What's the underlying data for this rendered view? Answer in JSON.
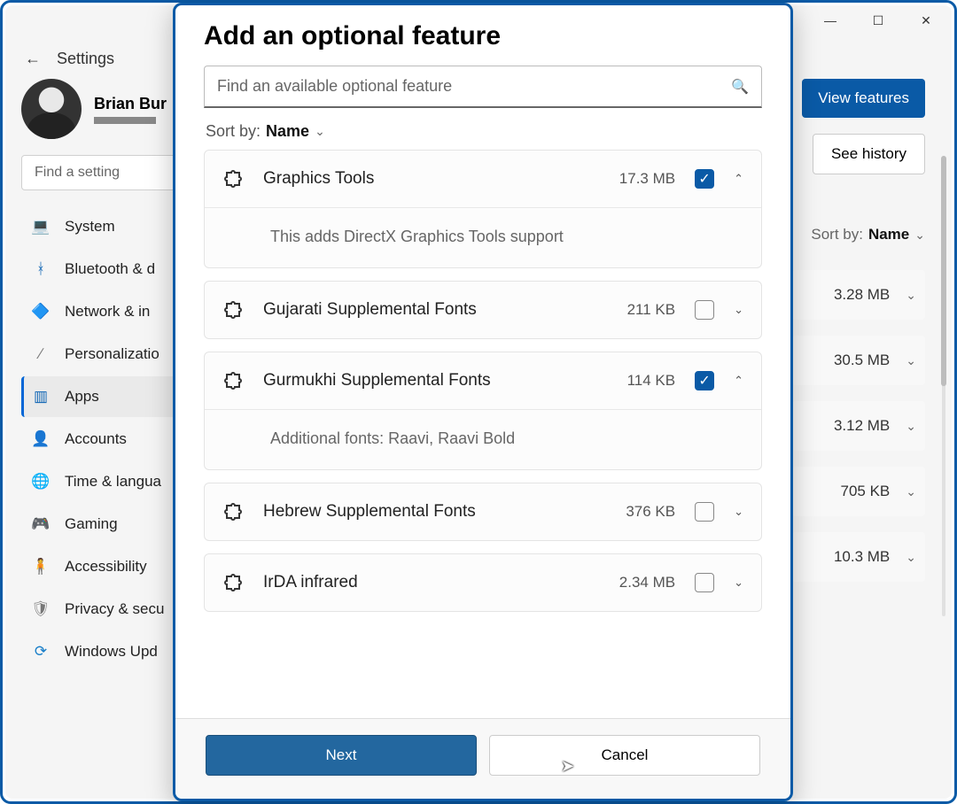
{
  "window": {
    "titlebar": {
      "min": "—",
      "max": "☐",
      "close": "✕"
    },
    "back_icon": "←",
    "app_title": "Settings"
  },
  "user": {
    "name": "Brian Bur"
  },
  "find_setting_placeholder": "Find a setting",
  "sidebar": {
    "items": [
      {
        "label": "System",
        "icon": "💻",
        "color": "#0a62b3"
      },
      {
        "label": "Bluetooth & d",
        "icon": "ᚼ",
        "color": "#0a62b3"
      },
      {
        "label": "Network & in",
        "icon": "🔷",
        "color": "#0a62b3"
      },
      {
        "label": "Personalizatio",
        "icon": "∕",
        "color": "#777"
      },
      {
        "label": "Apps",
        "icon": "▥",
        "color": "#0a62b3",
        "active": true
      },
      {
        "label": "Accounts",
        "icon": "👤",
        "color": "#0a62b3"
      },
      {
        "label": "Time & langua",
        "icon": "🌐",
        "color": "#1a7fc9"
      },
      {
        "label": "Gaming",
        "icon": "🎮",
        "color": "#777"
      },
      {
        "label": "Accessibility",
        "icon": "🧍",
        "color": "#0a62b3"
      },
      {
        "label": "Privacy & secu",
        "icon": "🛡",
        "color": "#777"
      },
      {
        "label": "Windows Upd",
        "icon": "⟳",
        "color": "#1a7fc9"
      }
    ]
  },
  "main": {
    "view_features": "View features",
    "see_history": "See history",
    "sort_label": "Sort by:",
    "sort_value": "Name",
    "rows": [
      {
        "size": "3.28 MB"
      },
      {
        "size": "30.5 MB"
      },
      {
        "size": "3.12 MB"
      },
      {
        "size": "705 KB"
      },
      {
        "size": "10.3 MB"
      }
    ]
  },
  "modal": {
    "title": "Add an optional feature",
    "search_placeholder": "Find an available optional feature",
    "sort_label": "Sort by:",
    "sort_value": "Name",
    "next": "Next",
    "cancel": "Cancel",
    "features": [
      {
        "name": "Graphics Tools",
        "size": "17.3 MB",
        "checked": true,
        "expanded": true,
        "description": "This adds DirectX Graphics Tools support"
      },
      {
        "name": "Gujarati Supplemental Fonts",
        "size": "211 KB",
        "checked": false,
        "expanded": false
      },
      {
        "name": "Gurmukhi Supplemental Fonts",
        "size": "114 KB",
        "checked": true,
        "expanded": true,
        "description": "Additional fonts: Raavi, Raavi Bold"
      },
      {
        "name": "Hebrew Supplemental Fonts",
        "size": "376 KB",
        "checked": false,
        "expanded": false
      },
      {
        "name": "IrDA infrared",
        "size": "2.34 MB",
        "checked": false,
        "expanded": false
      }
    ]
  }
}
